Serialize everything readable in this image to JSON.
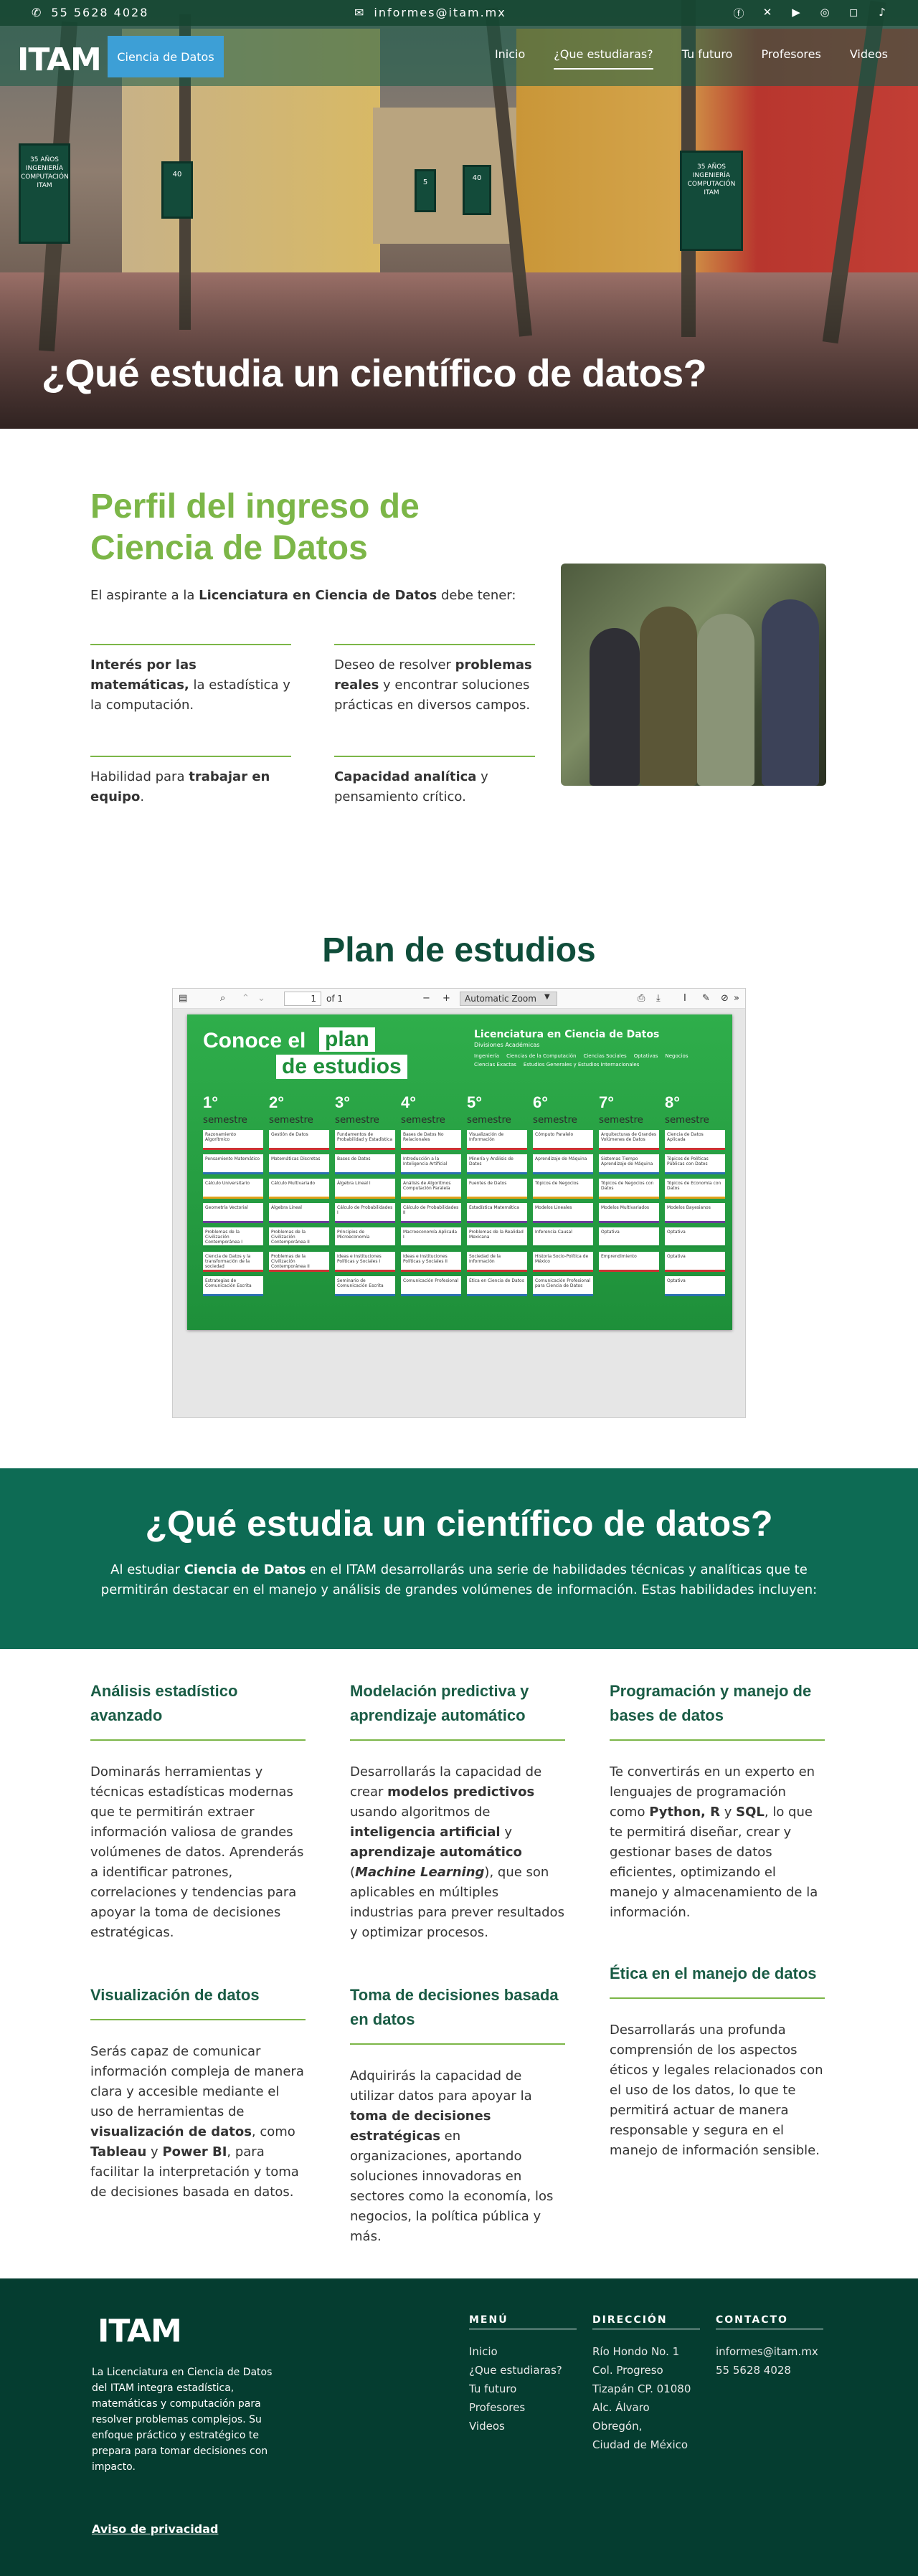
{
  "topbar": {
    "phone": "55 5628 4028",
    "email": "informes@itam.mx",
    "social_icons": [
      "facebook-icon",
      "x-icon",
      "youtube-icon",
      "whatsapp-icon",
      "instagram-icon",
      "tiktok-icon"
    ]
  },
  "nav": {
    "logo": "ITAM",
    "badge": "Ciencia de Datos",
    "items": [
      {
        "label": "Inicio"
      },
      {
        "label": "¿Que estudiaras?"
      },
      {
        "label": "Tu futuro"
      },
      {
        "label": "Profesores"
      },
      {
        "label": "Videos"
      }
    ]
  },
  "hero": {
    "title": "¿Qué estudia un científico de datos?",
    "banner_left": "35 AÑOS INGENIERÍA COMPUTACIÓN ITAM",
    "banner_right": "35 AÑOS INGENIERÍA COMPUTACIÓN ITAM",
    "banner_small_1": "40",
    "banner_small_2": "5",
    "banner_small_3": "40"
  },
  "perfil": {
    "title": "Perfil del ingreso de Ciencia de Datos",
    "intro_pre": "El aspirante a la ",
    "intro_bold": "Licenciatura en Ciencia de Datos",
    "intro_post": " debe tener:",
    "items": [
      {
        "bold": "Interés por las matemáticas,",
        "text": " la estadística y la computación."
      },
      {
        "pre": "Deseo de resolver ",
        "bold": "problemas reales",
        "text": " y encontrar soluciones prácticas en diversos campos."
      },
      {
        "pre": "Habilidad para ",
        "bold": "trabajar en equipo",
        "text": "."
      },
      {
        "bold": "Capacidad analítica",
        "text": " y pensamiento crítico."
      }
    ]
  },
  "plan": {
    "title": "Plan de estudios",
    "viewer": {
      "page": "1",
      "of": "of 1",
      "zoom": "Automatic Zoom"
    },
    "poster": {
      "line1": "Conoce el",
      "line1_hl": "plan",
      "line2_hl": "de estudios",
      "lic": "Licenciatura en Ciencia de Datos",
      "div": "Divisiones Académicas",
      "legend": [
        "Ingeniería",
        "Ciencias de la Computación",
        "Ciencias Sociales",
        "Optativas",
        "Negocios",
        "Ciencias Exactas",
        "Estudios Generales y Estudios Internacionales"
      ],
      "semesters": [
        {
          "n": "1°",
          "label": "semestre",
          "courses": [
            "Razonamiento Algorítmico",
            "Pensamiento Matemático",
            "Cálculo Universitario",
            "Geometría Vectorial",
            "Problemas de la Civilización Contemporánea I",
            "Ciencia de Datos y la transformación de la sociedad",
            "Estrategias de Comunicación Escrita"
          ]
        },
        {
          "n": "2°",
          "label": "semestre",
          "courses": [
            "Gestión de Datos",
            "Matemáticas Discretas",
            "Cálculo Multivariado",
            "Álgebra Lineal",
            "Problemas de la Civilización Contemporánea II",
            "Problemas de la Civilización Contemporánea II"
          ]
        },
        {
          "n": "3°",
          "label": "semestre",
          "courses": [
            "Fundamentos de Probabilidad y Estadística",
            "Bases de Datos",
            "Álgebra Lineal I",
            "Cálculo de Probabilidades I",
            "Principios de Microeconomía",
            "Ideas e Instituciones Políticas y Sociales I",
            "Seminario de Comunicación Escrita"
          ]
        },
        {
          "n": "4°",
          "label": "semestre",
          "courses": [
            "Bases de Datos No Relacionales",
            "Introducción a la Inteligencia Artificial",
            "Análisis de Algoritmos Computación Paralela",
            "Cálculo de Probabilidades II",
            "Macroeconomía Aplicada I",
            "Ideas e Instituciones Políticas y Sociales II",
            "Comunicación Profesional"
          ]
        },
        {
          "n": "5°",
          "label": "semestre",
          "courses": [
            "Visualización de Información",
            "Minería y Análisis de Datos",
            "Fuentes de Datos",
            "Estadística Matemática",
            "Problemas de la Realidad Mexicana",
            "Sociedad de la Información",
            "Ética en Ciencia de Datos"
          ]
        },
        {
          "n": "6°",
          "label": "semestre",
          "courses": [
            "Cómputo Paralelo",
            "Aprendizaje de Máquina",
            "Tópicos de Negocios",
            "Modelos Lineales",
            "Inferencia Causal",
            "Historia Socio-Política de México",
            "Comunicación Profesional para Ciencia de Datos"
          ]
        },
        {
          "n": "7°",
          "label": "semestre",
          "courses": [
            "Arquitecturas de Grandes Volúmenes de Datos",
            "Sistemas Tiempo Aprendizaje de Máquina",
            "Tópicos de Negocios con Datos",
            "Modelos Multivariados",
            "Optativa",
            "Emprendimiento"
          ]
        },
        {
          "n": "8°",
          "label": "semestre",
          "courses": [
            "Ciencia de Datos Aplicada",
            "Tópicos de Políticas Públicas con Datos",
            "Tópicos de Economía con Datos",
            "Modelos Bayesianos",
            "Optativa",
            "Optativa",
            "Optativa"
          ]
        }
      ]
    }
  },
  "estudia": {
    "title": "¿Qué estudia un científico de datos?",
    "text_pre": "Al estudiar ",
    "text_bold": "Ciencia de Datos",
    "text_post": " en el ITAM desarrollarás una serie de habilidades técnicas y analíticas que te permitirán destacar en el manejo y análisis de grandes volúmenes de información. Estas habilidades incluyen:"
  },
  "skills": [
    {
      "title": "Análisis estadístico avanzado",
      "text": "Dominarás herramientas y técnicas estadísticas modernas que te permitirán extraer información valiosa de grandes volúmenes de datos. Aprenderás a identificar patrones, correlaciones y tendencias para apoyar la toma de decisiones estratégicas."
    },
    {
      "title": "Modelación predictiva y aprendizaje automático",
      "text_pre": "Desarrollarás la capacidad de crear ",
      "bold1": "modelos predictivos",
      "text_mid1": " usando algoritmos de ",
      "bold2": "inteligencia artificial",
      "text_mid2": " y ",
      "bold3": "aprendizaje automático",
      "text_mid3": " (",
      "bold4": "Machine Learning",
      "text_post": "), que son aplicables en múltiples industrias para prever resultados y optimizar procesos."
    },
    {
      "title": "Programación y manejo de bases de datos",
      "text_pre": "Te convertirás en un experto en lenguajes de programación como ",
      "bold1": "Python, R",
      "text_mid1": " y ",
      "bold2": "SQL",
      "text_post": ", lo que te permitirá diseñar, crear y gestionar bases de datos eficientes, optimizando el manejo y almacenamiento de la información."
    },
    {
      "title": "Visualización de datos",
      "text_pre": "Serás capaz de comunicar información compleja de manera clara y accesible mediante el uso de herramientas de ",
      "bold1": "visualización de datos",
      "text_mid1": ", como ",
      "bold2": "Tableau",
      "text_mid2": " y ",
      "bold3": "Power BI",
      "text_post": ", para facilitar la interpretación y toma de decisiones basada en datos."
    },
    {
      "title": "Toma de decisiones basada en datos",
      "text_pre": "Adquirirás la capacidad de utilizar datos para apoyar la ",
      "bold1": "toma de decisiones estratégicas",
      "text_post": " en organizaciones, aportando soluciones innovadoras en sectores como la economía, los negocios, la política pública y más."
    },
    {
      "title": "Ética en el manejo de datos",
      "text": "Desarrollarás una profunda comprensión de los aspectos éticos y legales relacionados con el uso de los datos, lo que te permitirá actuar de manera responsable y segura en el manejo de información sensible."
    }
  ],
  "footer": {
    "logo": "ITAM",
    "description": "La Licenciatura en Ciencia de Datos del ITAM integra estadística, matemáticas y computación para resolver problemas complejos. Su enfoque práctico y estratégico te prepara para tomar decisiones con impacto.",
    "menu_title": "MENÚ",
    "menu": [
      "Inicio",
      "¿Que estudiaras?",
      "Tu futuro",
      "Profesores",
      "Videos"
    ],
    "address_title": "DIRECCIÓN",
    "address": [
      "Río Hondo No. 1",
      "Col. Progreso",
      "Tizapán CP. 01080",
      "Alc. Álvaro Obregón,",
      "Ciudad de México"
    ],
    "contact_title": "CONTACTO",
    "contact": [
      "informes@itam.mx",
      "55 5628 4028"
    ],
    "privacy": "Aviso de privacidad"
  },
  "colors": {
    "dark_green": "#053d30",
    "teal": "#0d6b54",
    "light_green": "#7cb648",
    "blue_badge": "#3d9fd6"
  }
}
